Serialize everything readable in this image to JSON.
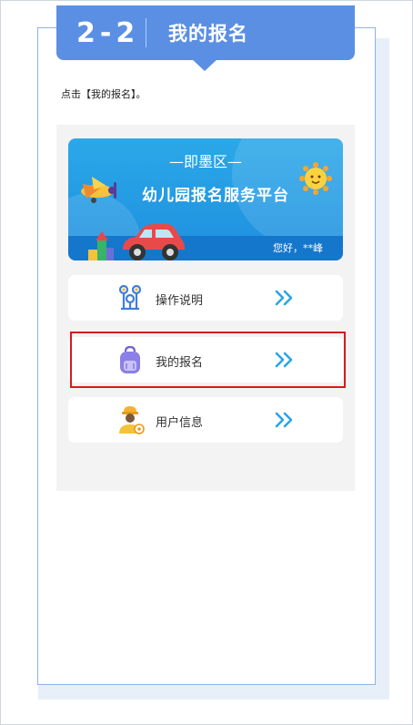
{
  "step": {
    "number": "2-2",
    "title": "我的报名"
  },
  "instruction": "点击【我的报名】。",
  "banner": {
    "district": "—即墨区—",
    "title": "幼儿园报名服务平台",
    "greeting": "您好，**峰"
  },
  "menu": [
    {
      "label": "操作说明",
      "icon": "operation-guide-icon"
    },
    {
      "label": "我的报名",
      "icon": "backpack-icon"
    },
    {
      "label": "用户信息",
      "icon": "user-info-icon"
    }
  ],
  "colors": {
    "header_blue": "#5a8fe3",
    "banner_blue": "#2ba8e8",
    "highlight_red": "#d61b1b",
    "arrow_blue": "#2aa4ec"
  }
}
